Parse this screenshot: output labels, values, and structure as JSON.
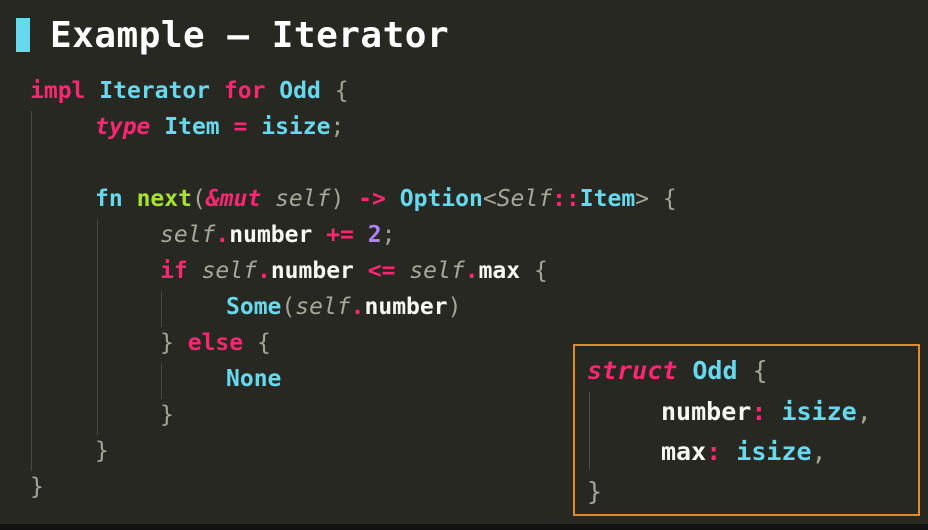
{
  "slide": {
    "title": "Example – Iterator",
    "accent_color": "#66d9ef"
  },
  "code": {
    "line1": {
      "impl": "impl",
      "iterator": "Iterator",
      "for": "for",
      "odd": "Odd",
      "brace": "{"
    },
    "line2": {
      "type": "type",
      "item": "Item",
      "eq": "=",
      "isize": "isize",
      "semi": ";"
    },
    "line4": {
      "fn": "fn",
      "next": "next",
      "lp": "(",
      "amp_mut": "&mut",
      "self": "self",
      "rp": ")",
      "arrow": "->",
      "option": "Option",
      "lt": "<",
      "self_ty": "Self",
      "colons": "::",
      "item": "Item",
      "gt": ">",
      "brace": "{"
    },
    "line5": {
      "self": "self",
      "dot": ".",
      "number": "number",
      "op": "+=",
      "num": "2",
      "semi": ";"
    },
    "line6": {
      "if": "if",
      "self1": "self",
      "dot1": ".",
      "number": "number",
      "op": "<=",
      "self2": "self",
      "dot2": ".",
      "max": "max",
      "brace": "{"
    },
    "line7": {
      "some": "Some",
      "lp": "(",
      "self": "self",
      "dot": ".",
      "number": "number",
      "rp": ")"
    },
    "line8": {
      "close": "}",
      "else": "else",
      "brace": "{"
    },
    "line9": {
      "none": "None"
    },
    "line10": {
      "close": "}"
    },
    "line11": {
      "close": "}"
    },
    "line12": {
      "close": "}"
    }
  },
  "struct_box": {
    "border_color": "#e08a2e",
    "line1": {
      "struct": "struct",
      "odd": "Odd",
      "brace": "{"
    },
    "line2": {
      "field": "number",
      "colon": ":",
      "type": "isize",
      "comma": ","
    },
    "line3": {
      "field": "max",
      "colon": ":",
      "type": "isize",
      "comma": ","
    },
    "line4": {
      "close": "}"
    }
  },
  "colors": {
    "background": "#272822",
    "keyword": "#f92672",
    "type": "#66d9ef",
    "function": "#a6e22e",
    "number": "#ae81ff",
    "punctuation": "#a5a596"
  }
}
